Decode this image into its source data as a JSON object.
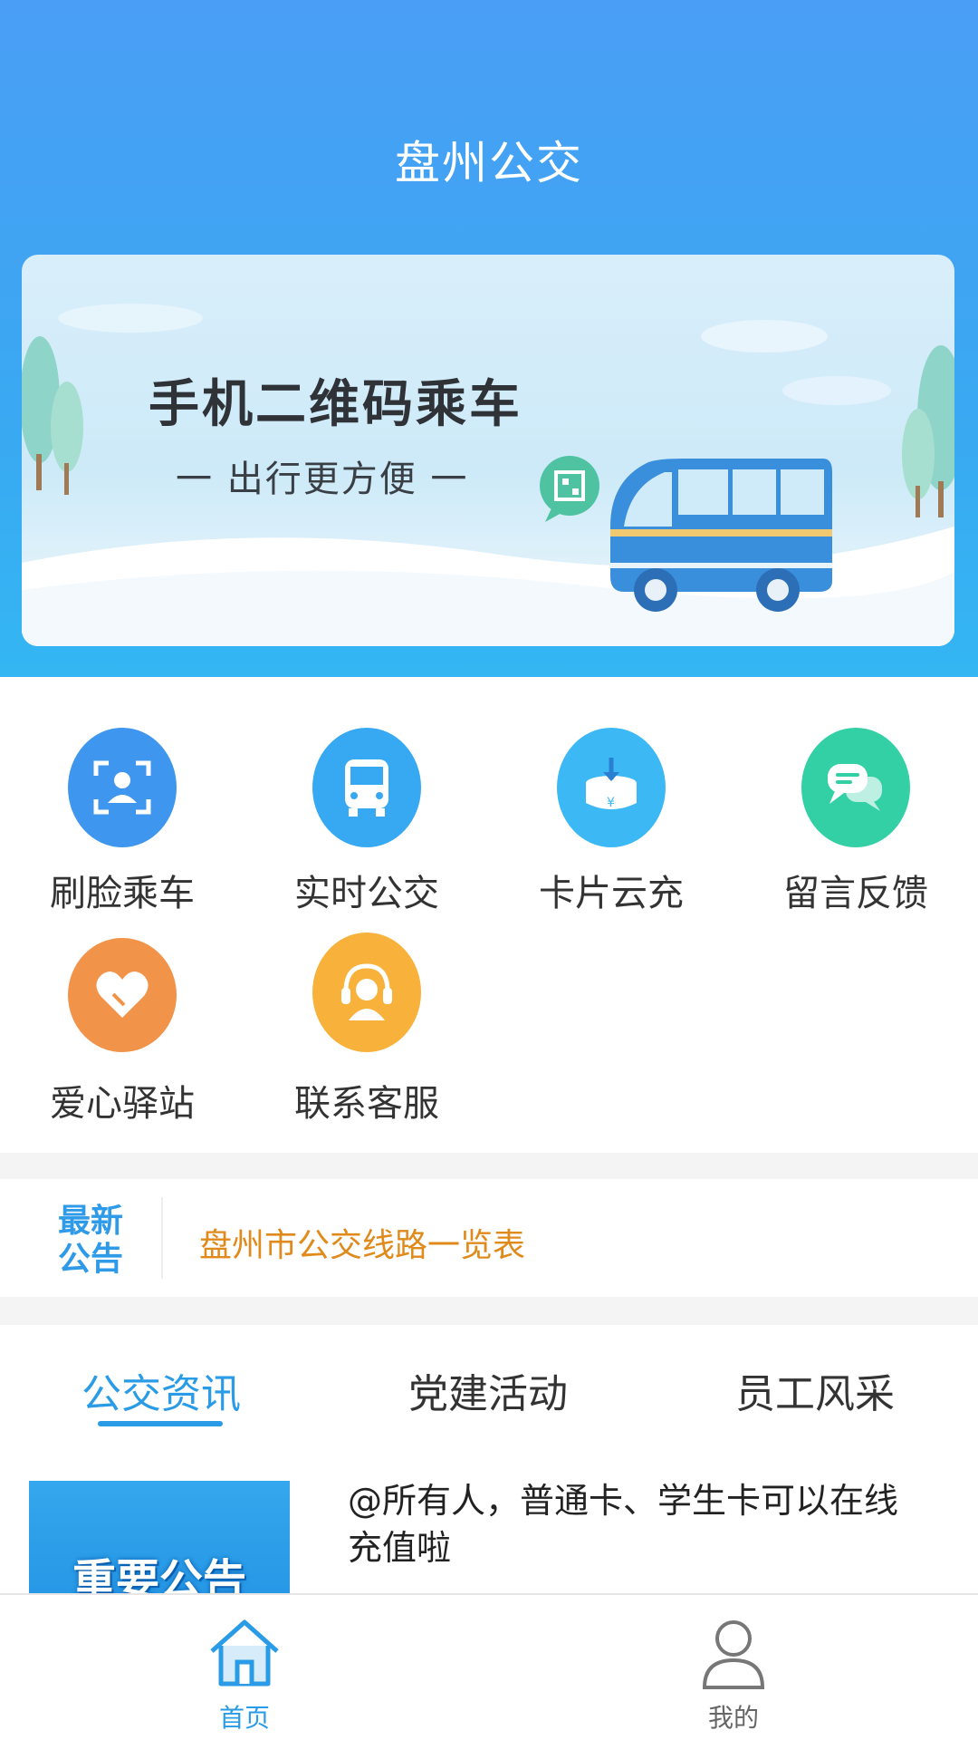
{
  "app": {
    "title": "盘州公交"
  },
  "banner": {
    "title": "手机二维码乘车",
    "subtitle": "一 出行更方便 一"
  },
  "functions": [
    {
      "label": "刷脸乘车",
      "icon": "face-scan-icon",
      "color": "#3f96ee"
    },
    {
      "label": "实时公交",
      "icon": "bus-icon",
      "color": "#36a9f2"
    },
    {
      "label": "卡片云充",
      "icon": "card-recharge-icon",
      "color": "#3cb8f5"
    },
    {
      "label": "留言反馈",
      "icon": "chat-bubbles-icon",
      "color": "#33d0a6"
    },
    {
      "label": "爱心驿站",
      "icon": "heart-icon",
      "color": "#f2934a"
    },
    {
      "label": "联系客服",
      "icon": "headset-icon",
      "color": "#f8b13a"
    }
  ],
  "notice": {
    "tag_line1": "最新",
    "tag_line2": "公告",
    "text": "盘州市公交线路一览表"
  },
  "news": {
    "tabs": [
      {
        "label": "公交资讯",
        "active": true
      },
      {
        "label": "党建活动",
        "active": false
      },
      {
        "label": "员工风采",
        "active": false
      }
    ],
    "items": [
      {
        "thumb_text": "重要公告",
        "title": "@所有人，普通卡、学生卡可以在线充值啦"
      }
    ]
  },
  "bottom_nav": [
    {
      "label": "首页",
      "icon": "home-icon",
      "active": true,
      "color": "#2a9be6"
    },
    {
      "label": "我的",
      "icon": "user-icon",
      "active": false,
      "color": "#777777"
    }
  ]
}
